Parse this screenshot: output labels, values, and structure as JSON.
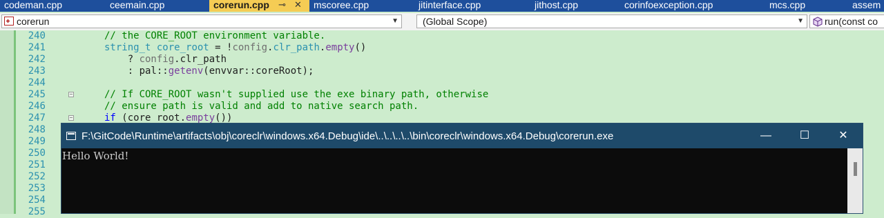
{
  "tabs": [
    {
      "label": "codeman.cpp"
    },
    {
      "label": "ceemain.cpp"
    },
    {
      "label": "corerun.cpp",
      "active": true
    },
    {
      "label": "mscoree.cpp"
    },
    {
      "label": "jitinterface.cpp"
    },
    {
      "label": "jithost.cpp"
    },
    {
      "label": "corinfoexception.cpp"
    },
    {
      "label": "mcs.cpp"
    },
    {
      "label": "assem"
    }
  ],
  "active_tab_icons": {
    "pin": "pin-icon",
    "close": "close-icon"
  },
  "navbar": {
    "project": "corerun",
    "scope": "(Global Scope)",
    "member": "run(const co",
    "icons": {
      "project": "cpp-project-icon",
      "member": "method-cube-icon",
      "dropdown": "chevron-down-icon"
    }
  },
  "editor": {
    "lines": [
      {
        "num": "240",
        "tokens": [
          {
            "t": "// the CORE_ROOT environment variable.",
            "k": "comment"
          }
        ]
      },
      {
        "num": "241",
        "tokens": [
          {
            "t": "string_t",
            "k": "type"
          },
          {
            "t": " ",
            "k": "id"
          },
          {
            "t": "core_root",
            "k": "type"
          },
          {
            "t": " = !",
            "k": "id"
          },
          {
            "t": "config",
            "k": "gray"
          },
          {
            "t": ".",
            "k": "id"
          },
          {
            "t": "clr_path",
            "k": "type"
          },
          {
            "t": ".",
            "k": "id"
          },
          {
            "t": "empty",
            "k": "func"
          },
          {
            "t": "()",
            "k": "id"
          }
        ]
      },
      {
        "num": "242",
        "tokens": [
          {
            "t": "    ? ",
            "k": "id"
          },
          {
            "t": "config",
            "k": "gray"
          },
          {
            "t": ".",
            "k": "id"
          },
          {
            "t": "clr_path",
            "k": "id"
          }
        ]
      },
      {
        "num": "243",
        "tokens": [
          {
            "t": "    : pal::",
            "k": "id"
          },
          {
            "t": "getenv",
            "k": "func"
          },
          {
            "t": "(envvar::coreRoot);",
            "k": "id"
          }
        ]
      },
      {
        "num": "244",
        "tokens": []
      },
      {
        "num": "245",
        "fold": true,
        "tokens": [
          {
            "t": "// If CORE_ROOT wasn't supplied use the exe binary path, otherwise",
            "k": "comment"
          }
        ]
      },
      {
        "num": "246",
        "tokens": [
          {
            "t": "// ensure path is valid and add to native search path.",
            "k": "comment"
          }
        ]
      },
      {
        "num": "247",
        "fold": true,
        "tokens": [
          {
            "t": "if",
            "k": "keyword"
          },
          {
            "t": " (core_root.",
            "k": "id"
          },
          {
            "t": "empty",
            "k": "func"
          },
          {
            "t": "())",
            "k": "id"
          }
        ]
      },
      {
        "num": "248",
        "tokens": []
      },
      {
        "num": "249",
        "tokens": []
      },
      {
        "num": "250",
        "tokens": []
      },
      {
        "num": "251",
        "tokens": []
      },
      {
        "num": "252",
        "tokens": []
      },
      {
        "num": "253",
        "tokens": []
      },
      {
        "num": "254",
        "tokens": []
      },
      {
        "num": "255",
        "tokens": []
      }
    ],
    "colors": {
      "background": "#cdeccd",
      "line_number": "#2b91af",
      "comment": "#008000",
      "keyword": "#0000ff"
    }
  },
  "console": {
    "title": "F:\\GitCode\\Runtime\\artifacts\\obj\\coreclr\\windows.x64.Debug\\ide\\..\\..\\..\\..\\bin\\coreclr\\windows.x64.Debug\\corerun.exe",
    "output": "Hello World!",
    "buttons": {
      "minimize": "—",
      "maximize": "☐",
      "close": "✕"
    },
    "icons": {
      "app": "console-app-icon",
      "minimize": "minimize-icon",
      "maximize": "maximize-icon",
      "close": "close-icon"
    },
    "colors": {
      "titlebar": "#1e4a6a",
      "background": "#0c0c0c",
      "text": "#cccccc"
    }
  }
}
